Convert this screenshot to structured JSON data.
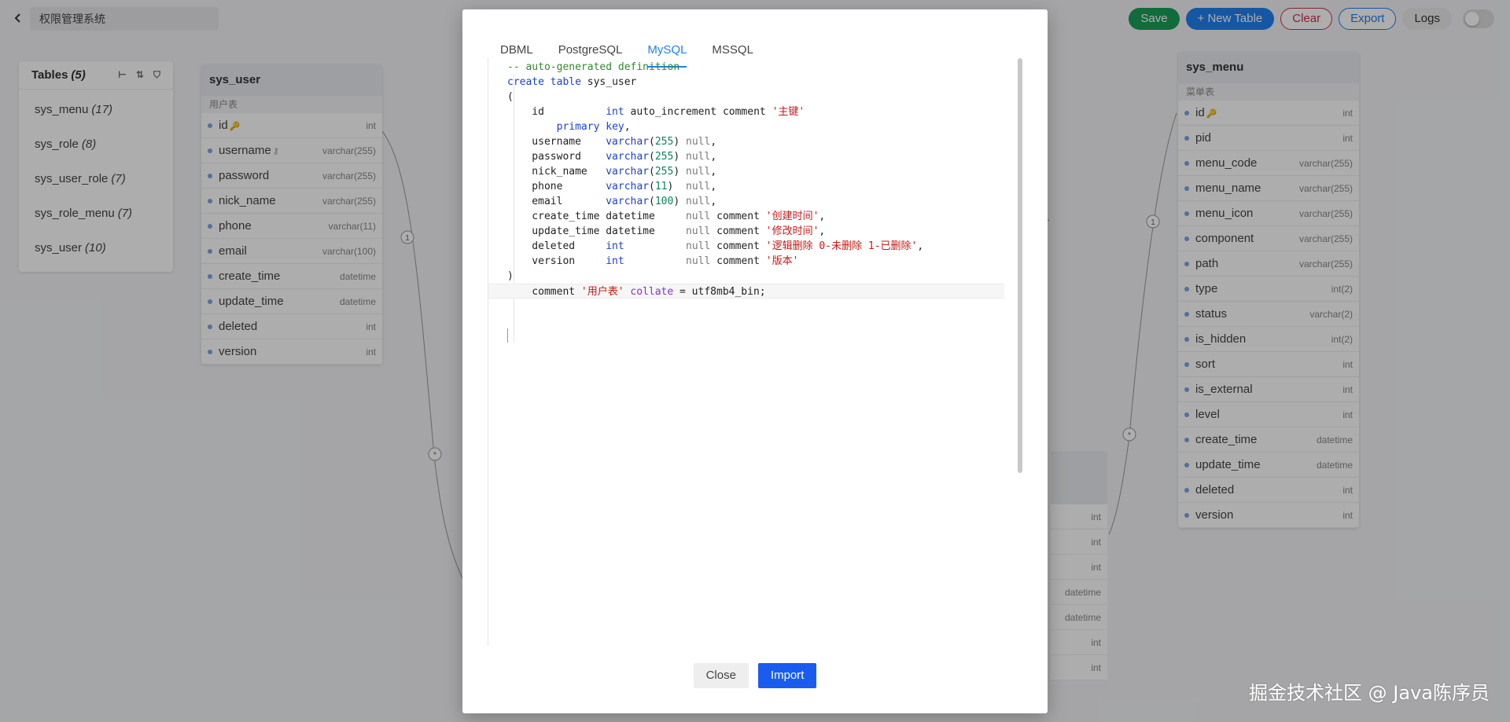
{
  "header": {
    "project_name": "权限管理系统",
    "buttons": {
      "save": "Save",
      "new_table": "+ New Table",
      "clear": "Clear",
      "export": "Export",
      "logs": "Logs"
    }
  },
  "tables_panel": {
    "title": "Tables",
    "count": "(5)",
    "items": [
      {
        "name": "sys_menu",
        "count": "(17)"
      },
      {
        "name": "sys_role",
        "count": "(8)"
      },
      {
        "name": "sys_user_role",
        "count": "(7)"
      },
      {
        "name": "sys_role_menu",
        "count": "(7)"
      },
      {
        "name": "sys_user",
        "count": "(10)"
      }
    ]
  },
  "sys_user_card": {
    "title": "sys_user",
    "subtitle": "用户表",
    "fields": [
      {
        "name": "id",
        "type": "int",
        "key": "pk"
      },
      {
        "name": "username",
        "type": "varchar(255)",
        "key": "unique"
      },
      {
        "name": "password",
        "type": "varchar(255)"
      },
      {
        "name": "nick_name",
        "type": "varchar(255)"
      },
      {
        "name": "phone",
        "type": "varchar(11)"
      },
      {
        "name": "email",
        "type": "varchar(100)"
      },
      {
        "name": "create_time",
        "type": "datetime"
      },
      {
        "name": "update_time",
        "type": "datetime"
      },
      {
        "name": "deleted",
        "type": "int"
      },
      {
        "name": "version",
        "type": "int"
      }
    ]
  },
  "sys_menu_card": {
    "title": "sys_menu",
    "subtitle": "菜单表",
    "fields": [
      {
        "name": "id",
        "type": "int",
        "key": "pk"
      },
      {
        "name": "pid",
        "type": "int"
      },
      {
        "name": "menu_code",
        "type": "varchar(255)"
      },
      {
        "name": "menu_name",
        "type": "varchar(255)"
      },
      {
        "name": "menu_icon",
        "type": "varchar(255)"
      },
      {
        "name": "component",
        "type": "varchar(255)"
      },
      {
        "name": "path",
        "type": "varchar(255)"
      },
      {
        "name": "type",
        "type": "int(2)"
      },
      {
        "name": "status",
        "type": "varchar(2)"
      },
      {
        "name": "is_hidden",
        "type": "int(2)"
      },
      {
        "name": "sort",
        "type": "int"
      },
      {
        "name": "is_external",
        "type": "int"
      },
      {
        "name": "level",
        "type": "int"
      },
      {
        "name": "create_time",
        "type": "datetime"
      },
      {
        "name": "update_time",
        "type": "datetime"
      },
      {
        "name": "deleted",
        "type": "int"
      },
      {
        "name": "version",
        "type": "int"
      }
    ]
  },
  "partial_card": {
    "types": [
      "int",
      "int",
      "int",
      "datetime",
      "datetime",
      "int",
      "int"
    ]
  },
  "relations": {
    "labels": [
      "1",
      "*",
      "1",
      "*"
    ]
  },
  "modal": {
    "tabs": [
      "DBML",
      "PostgreSQL",
      "MySQL",
      "MSSQL"
    ],
    "active_tab": "MySQL",
    "code_lines": [
      "-- auto-generated definition",
      "create table sys_user",
      "(",
      "    id          int auto_increment comment '主键'",
      "        primary key,",
      "    username    varchar(255) null,",
      "    password    varchar(255) null,",
      "    nick_name   varchar(255) null,",
      "    phone       varchar(11)  null,",
      "    email       varchar(100) null,",
      "    create_time datetime     null comment '创建时间',",
      "    update_time datetime     null comment '修改时间',",
      "    deleted     int          null comment '逻辑删除 0-未删除 1-已删除',",
      "    version     int          null comment '版本'",
      ")",
      "    comment '用户表' collate = utf8mb4_bin;"
    ],
    "buttons": {
      "close": "Close",
      "import": "Import"
    }
  },
  "watermark": "掘金技术社区 @ Java陈序员"
}
